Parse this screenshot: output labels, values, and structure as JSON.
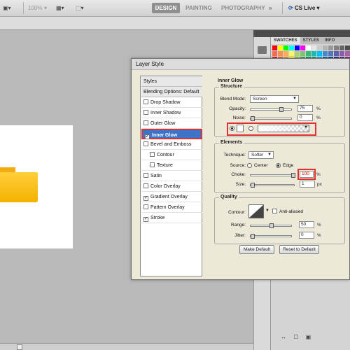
{
  "appbar": {
    "zoom": "100%",
    "zoom_arrow": "▾",
    "workspaces": [
      "DESIGN",
      "PAINTING",
      "PHOTOGRAPHY"
    ],
    "more": "»",
    "cs_live": "CS Live ▾"
  },
  "panel": {
    "tabs": [
      "SWATCHES",
      "STYLES",
      "INFO"
    ],
    "bottom_icons": "↔ ☐ ▣",
    "swatch_colors": [
      "#ff0000",
      "#ffff00",
      "#00ff00",
      "#00ffff",
      "#0000ff",
      "#ff00ff",
      "#ffffff",
      "#e6e6e6",
      "#cccccc",
      "#b3b3b3",
      "#999999",
      "#808080",
      "#666666",
      "#4d4d4d",
      "#f26c4f",
      "#f68e55",
      "#fbaf5c",
      "#fff467",
      "#acd372",
      "#7cc576",
      "#3bb878",
      "#1abbb4",
      "#00bff3",
      "#438ccb",
      "#5574b9",
      "#605ca8",
      "#855fa8",
      "#a763a8",
      "#ed1c24",
      "#f26522",
      "#f7941d",
      "#fff200",
      "#8dc63f",
      "#39b54a",
      "#00a651",
      "#00a99d",
      "#00aeef",
      "#0072bc",
      "#0054a6",
      "#2e3192",
      "#662d91",
      "#92278f",
      "#9e0b0f",
      "#a0410d",
      "#a3620a",
      "#aba000",
      "#598527",
      "#1a7b30",
      "#007236",
      "#00746b",
      "#0076a3",
      "#004b80",
      "#003471",
      "#1b1464",
      "#440e62",
      "#630460"
    ]
  },
  "dialog": {
    "title": "Layer Style",
    "list": [
      {
        "label": "Styles",
        "type": "head"
      },
      {
        "label": "Blending Options: Default",
        "type": "head"
      },
      {
        "label": "Drop Shadow",
        "checked": false
      },
      {
        "label": "Inner Shadow",
        "checked": false
      },
      {
        "label": "Outer Glow",
        "checked": false
      },
      {
        "label": "Inner Glow",
        "checked": true,
        "selected": true
      },
      {
        "label": "Bevel and Emboss",
        "checked": false
      },
      {
        "label": "Contour",
        "checked": false,
        "indent": true
      },
      {
        "label": "Texture",
        "checked": false,
        "indent": true
      },
      {
        "label": "Satin",
        "checked": false
      },
      {
        "label": "Color Overlay",
        "checked": false
      },
      {
        "label": "Gradient Overlay",
        "checked": true
      },
      {
        "label": "Pattern Overlay",
        "checked": false
      },
      {
        "label": "Stroke",
        "checked": true
      }
    ],
    "check_mark": "✓",
    "section_title": "Inner Glow",
    "structure": {
      "title": "Structure",
      "blend_mode_label": "Blend Mode:",
      "blend_mode": "Screen",
      "opacity_label": "Opacity:",
      "opacity": "75",
      "opacity_fraction": 0.75,
      "noise_label": "Noise:",
      "noise": "0",
      "noise_fraction": 0,
      "percent": "%"
    },
    "elements": {
      "title": "Elements",
      "technique_label": "Technique:",
      "technique": "Softer",
      "source_label": "Source:",
      "source_center": "Center",
      "source_edge": "Edge",
      "choke_label": "Choke:",
      "choke": "100",
      "choke_fraction": 1.0,
      "size_label": "Size:",
      "size": "1",
      "size_fraction": 0.0,
      "px": "px",
      "percent": "%"
    },
    "quality": {
      "title": "Quality",
      "contour_label": "Contour:",
      "anti_aliased_label": "Anti-aliased",
      "range_label": "Range:",
      "range": "50",
      "range_fraction": 0.5,
      "jitter_label": "Jitter:",
      "jitter": "0",
      "jitter_fraction": 0,
      "percent": "%"
    },
    "make_default": "Make Default",
    "reset_default": "Reset to Default"
  },
  "colors": {
    "accent": "#e03030",
    "selection": "#3c74c9",
    "folder": "#f5b100"
  }
}
